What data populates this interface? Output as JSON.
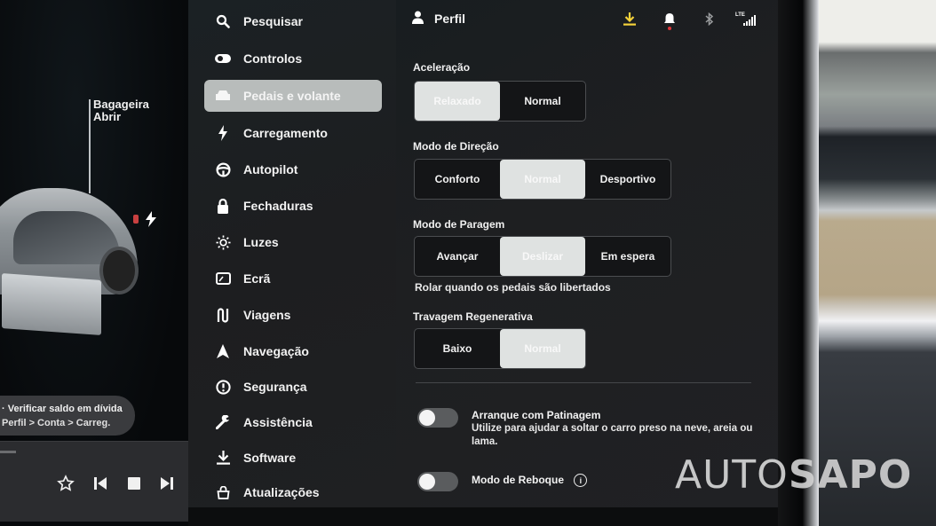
{
  "car_view": {
    "trunk_label": "Bagageira",
    "trunk_action": "Abrir",
    "notification": {
      "line1": "· Verificar saldo em dívida",
      "line2": "Perfil > Conta > Carreg."
    },
    "media_controls": [
      "favorite",
      "previous",
      "stop",
      "next"
    ]
  },
  "nav": {
    "active_index": 2,
    "items": [
      {
        "label": "Pesquisar",
        "icon": "search-icon"
      },
      {
        "label": "Controlos",
        "icon": "toggle-icon"
      },
      {
        "label": "Pedais e volante",
        "icon": "car-icon"
      },
      {
        "label": "Carregamento",
        "icon": "bolt-icon"
      },
      {
        "label": "Autopilot",
        "icon": "steering-wheel-icon"
      },
      {
        "label": "Fechaduras",
        "icon": "lock-icon"
      },
      {
        "label": "Luzes",
        "icon": "sun-icon"
      },
      {
        "label": "Ecrã",
        "icon": "display-icon"
      },
      {
        "label": "Viagens",
        "icon": "route-icon"
      },
      {
        "label": "Navegação",
        "icon": "navigation-arrow-icon"
      },
      {
        "label": "Segurança",
        "icon": "alert-circle-icon"
      },
      {
        "label": "Assistência",
        "icon": "wrench-icon"
      },
      {
        "label": "Software",
        "icon": "download-icon"
      },
      {
        "label": "Atualizações",
        "icon": "update-bag-icon"
      }
    ]
  },
  "header": {
    "profile_label": "Perfil",
    "status": {
      "download_color": "#f5d23a",
      "notification_dot_color": "#e0363a",
      "network": "LTE"
    }
  },
  "settings": {
    "acceleration": {
      "label": "Aceleração",
      "options": [
        "Relaxado",
        "Normal"
      ],
      "selected": "Relaxado"
    },
    "steering_mode": {
      "label": "Modo de Direção",
      "options": [
        "Conforto",
        "Normal",
        "Desportivo"
      ],
      "selected": "Normal"
    },
    "stopping_mode": {
      "label": "Modo de Paragem",
      "options": [
        "Avançar",
        "Deslizar",
        "Em espera"
      ],
      "selected": "Deslizar",
      "helper": "Rolar quando os pedais são libertados"
    },
    "regen_braking": {
      "label": "Travagem Regenerativa",
      "options": [
        "Baixo",
        "Normal"
      ],
      "selected": "Normal"
    },
    "slip_start": {
      "title": "Arranque com Patinagem",
      "description": "Utilize para ajudar a soltar o carro preso na neve, areia ou lama.",
      "enabled": false
    },
    "tow_mode": {
      "title": "Modo de Reboque",
      "enabled": false
    }
  },
  "watermark": {
    "part1": "AUTO",
    "part2": "SAPO"
  }
}
